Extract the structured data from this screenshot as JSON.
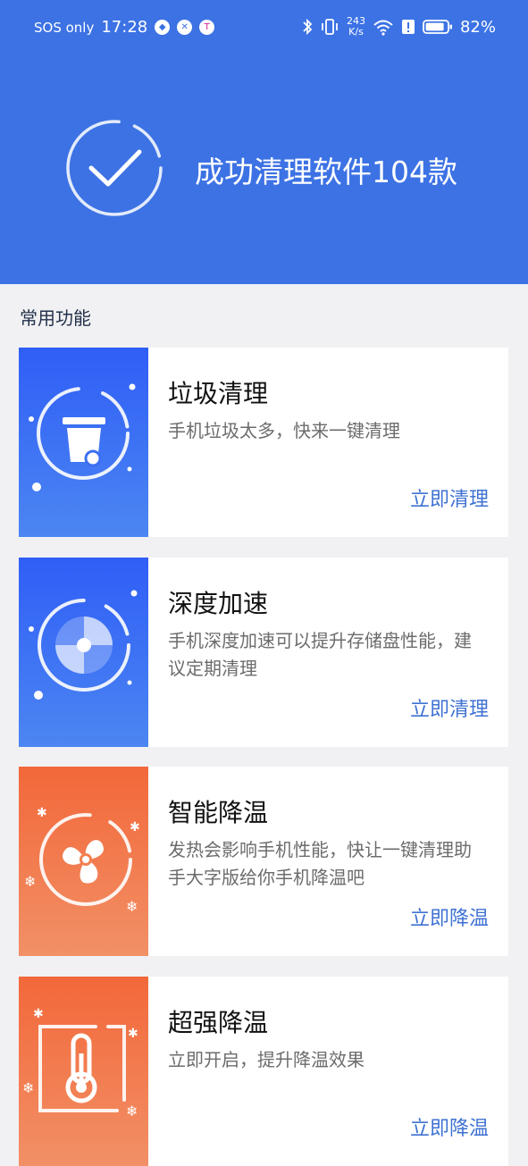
{
  "status_bar": {
    "carrier": "SOS only",
    "time": "17:28",
    "net_speed_value": "243",
    "net_speed_unit": "K/s",
    "battery": "82%"
  },
  "header": {
    "title": "成功清理软件104款"
  },
  "section": {
    "title": "常用功能"
  },
  "cards": [
    {
      "title": "垃圾清理",
      "desc": "手机垃圾太多，快来一键清理",
      "action": "立即清理",
      "icon": "trash-icon"
    },
    {
      "title": "深度加速",
      "desc": "手机深度加速可以提升存储盘性能，建议定期清理",
      "action": "立即清理",
      "icon": "speed-disc-icon"
    },
    {
      "title": "智能降温",
      "desc": "发热会影响手机性能，快让一键清理助手大字版给你手机降温吧",
      "action": "立即降温",
      "icon": "fan-icon"
    },
    {
      "title": "超强降温",
      "desc": "立即开启，提升降温效果",
      "action": "立即降温",
      "icon": "thermometer-icon"
    }
  ],
  "colors": {
    "header_blue": "#3c72e4",
    "action_blue": "#3f72d2",
    "orange": "#f2683a"
  }
}
